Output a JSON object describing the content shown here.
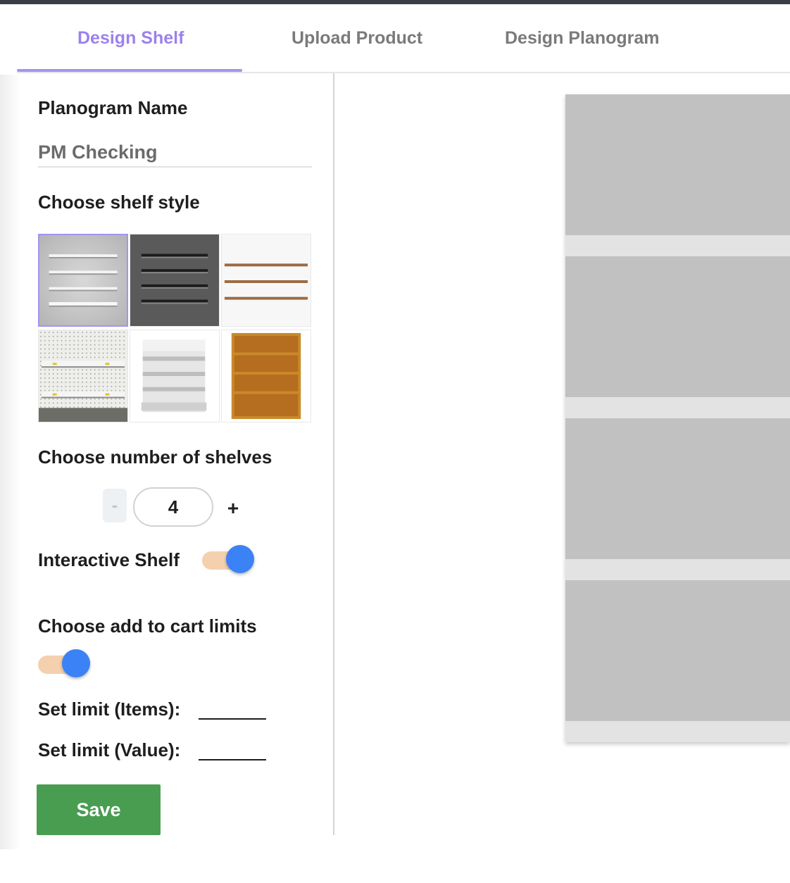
{
  "tabs": [
    {
      "label": "Design Shelf",
      "active": true
    },
    {
      "label": "Upload Product",
      "active": false
    },
    {
      "label": "Design Planogram",
      "active": false
    }
  ],
  "form": {
    "planogram_name_label": "Planogram Name",
    "planogram_name_value": "PM Checking",
    "shelf_style_label": "Choose shelf style",
    "shelf_styles": [
      {
        "name": "white-floating-shelves",
        "selected": true
      },
      {
        "name": "dark-floating-shelves",
        "selected": false
      },
      {
        "name": "wooden-plank-shelves",
        "selected": false
      },
      {
        "name": "pegboard-shelves",
        "selected": false
      },
      {
        "name": "white-gondola-shelves",
        "selected": false
      },
      {
        "name": "wooden-bookcase-shelves",
        "selected": false
      }
    ],
    "num_shelves_label": "Choose number of shelves",
    "num_shelves_minus": "-",
    "num_shelves_value": "4",
    "num_shelves_plus": "+",
    "interactive_shelf_label": "Interactive Shelf",
    "interactive_shelf_on": true,
    "cart_limits_label": "Choose add to cart limits",
    "cart_limits_on": true,
    "limit_items_label": "Set limit (Items):",
    "limit_value_label": "Set limit (Value):",
    "save_label": "Save"
  },
  "colors": {
    "accent": "#9b82ec",
    "toggle_knob": "#3b82f6",
    "toggle_track": "#f5d0ae",
    "save_button": "#489d51",
    "shelf_bay": "#c1c1c1",
    "shelf_ledge": "#e3e3e3"
  },
  "preview": {
    "shelf_count": 4
  }
}
